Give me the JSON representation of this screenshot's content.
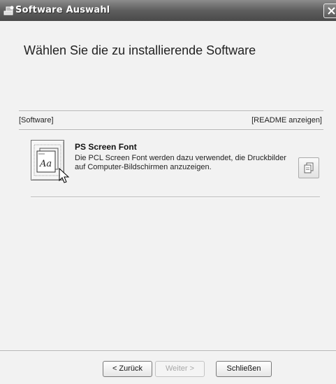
{
  "window": {
    "title": "Software Auswahl"
  },
  "heading": "Wählen Sie die zu installierende Software",
  "list_header": {
    "software": "[Software]",
    "readme": "[README anzeigen]"
  },
  "items": [
    {
      "title": "PS Screen Font",
      "description": "Die PCL Screen Font werden dazu verwendet, die Druckbilder\nauf Computer-Bildschirmen anzuzeigen.",
      "icon": "font-install-icon",
      "readme_icon": "document-copy-icon"
    }
  ],
  "buttons": {
    "back": "< Zurück",
    "next": "Weiter >",
    "close": "Schließen"
  },
  "colors": {
    "titlebar": "#5e5e5e",
    "title_text": "#ffffff",
    "background": "#f2f2f2",
    "disabled_text": "#a8a8a8"
  }
}
